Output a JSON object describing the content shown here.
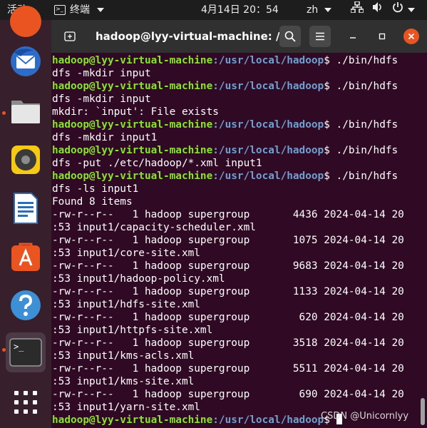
{
  "topbar": {
    "activities": "活动",
    "app_name": "终端",
    "clock": "4月14日 20：54",
    "language": "zh"
  },
  "colors": {
    "terminal_bg": "#300a24",
    "prompt_user": "#8ae234",
    "prompt_path": "#729fcf",
    "accent": "#e95420",
    "titlebar": "#303030",
    "topbar": "#1d1d1d",
    "dock": "#37202c"
  },
  "dock": {
    "items": [
      {
        "name": "thunderbird-icon",
        "running": false
      },
      {
        "name": "files-icon",
        "running": true
      },
      {
        "name": "rhythmbox-icon",
        "running": false
      },
      {
        "name": "libreoffice-writer-icon",
        "running": false
      },
      {
        "name": "software-center-icon",
        "running": false
      },
      {
        "name": "help-icon",
        "running": false
      },
      {
        "name": "terminal-icon",
        "running": true,
        "active": true
      },
      {
        "name": "show-apps-icon",
        "running": false
      }
    ]
  },
  "window": {
    "title": "hadoop@lyy-virtual-machine: /..."
  },
  "terminal": {
    "prompt_user": "hadoop@lyy-virtual-machine",
    "prompt_path": ":/usr/local/hadoop",
    "prompt_suffix": "$ ",
    "lines": [
      {
        "type": "prompt",
        "cmd": "./bin/hdfs"
      },
      {
        "type": "out",
        "text": "dfs -mkdir input"
      },
      {
        "type": "prompt",
        "cmd": "./bin/hdfs"
      },
      {
        "type": "out",
        "text": "dfs -mkdir input"
      },
      {
        "type": "out",
        "text": "mkdir: `input': File exists"
      },
      {
        "type": "prompt",
        "cmd": "./bin/hdfs"
      },
      {
        "type": "out",
        "text": "dfs -mkdir input1"
      },
      {
        "type": "prompt",
        "cmd": "./bin/hdfs"
      },
      {
        "type": "out",
        "text": "dfs -put ./etc/hadoop/*.xml input1"
      },
      {
        "type": "prompt",
        "cmd": "./bin/hdfs"
      },
      {
        "type": "out",
        "text": "dfs -ls input1"
      },
      {
        "type": "out",
        "text": "Found 8 items"
      },
      {
        "type": "out",
        "text": "-rw-r--r--   1 hadoop supergroup       4436 2024-04-14 20"
      },
      {
        "type": "out",
        "text": ":53 input1/capacity-scheduler.xml"
      },
      {
        "type": "out",
        "text": "-rw-r--r--   1 hadoop supergroup       1075 2024-04-14 20"
      },
      {
        "type": "out",
        "text": ":53 input1/core-site.xml"
      },
      {
        "type": "out",
        "text": "-rw-r--r--   1 hadoop supergroup       9683 2024-04-14 20"
      },
      {
        "type": "out",
        "text": ":53 input1/hadoop-policy.xml"
      },
      {
        "type": "out",
        "text": "-rw-r--r--   1 hadoop supergroup       1133 2024-04-14 20"
      },
      {
        "type": "out",
        "text": ":53 input1/hdfs-site.xml"
      },
      {
        "type": "out",
        "text": "-rw-r--r--   1 hadoop supergroup        620 2024-04-14 20"
      },
      {
        "type": "out",
        "text": ":53 input1/httpfs-site.xml"
      },
      {
        "type": "out",
        "text": "-rw-r--r--   1 hadoop supergroup       3518 2024-04-14 20"
      },
      {
        "type": "out",
        "text": ":53 input1/kms-acls.xml"
      },
      {
        "type": "out",
        "text": "-rw-r--r--   1 hadoop supergroup       5511 2024-04-14 20"
      },
      {
        "type": "out",
        "text": ":53 input1/kms-site.xml"
      },
      {
        "type": "out",
        "text": "-rw-r--r--   1 hadoop supergroup        690 2024-04-14 20"
      },
      {
        "type": "out",
        "text": ":53 input1/yarn-site.xml"
      },
      {
        "type": "prompt",
        "cmd": "",
        "cursor": true
      }
    ]
  },
  "watermark": "CSDN @Unicornlyy"
}
